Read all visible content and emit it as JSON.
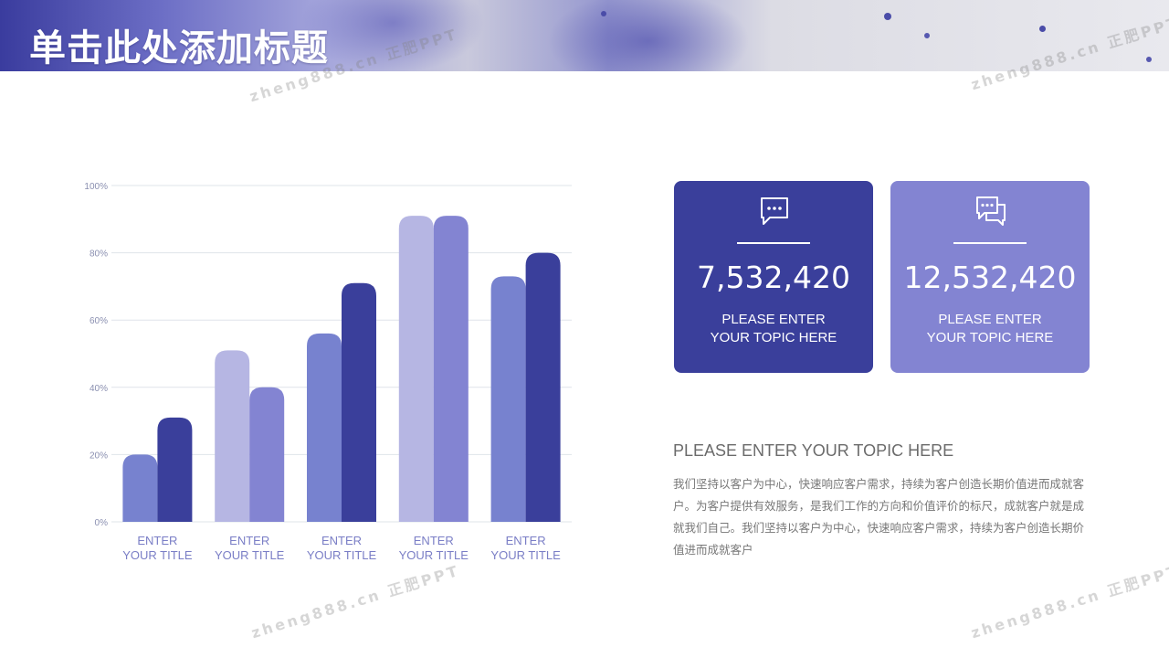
{
  "header": {
    "title": "单击此处添加标题"
  },
  "watermark": {
    "text": "zheng888.cn 正肥PPT"
  },
  "colors": {
    "dark": "#3a3f9b",
    "medium": "#8384d2",
    "light": "#b6b6e3",
    "steel": "#7782cf",
    "grid": "#dfe4ea",
    "axis_text": "#8a8fb0",
    "category_text": "#7a7ec6"
  },
  "chart_data": {
    "type": "bar",
    "categories": [
      "ENTER\nYOUR TITLE",
      "ENTER\nYOUR TITLE",
      "ENTER\nYOUR TITLE",
      "ENTER\nYOUR TITLE",
      "ENTER\nYOUR TITLE"
    ],
    "series": [
      {
        "values": [
          20,
          51,
          56,
          91,
          73
        ],
        "colors": [
          "#7782cf",
          "#b6b6e3",
          "#7782cf",
          "#b6b6e3",
          "#7782cf"
        ]
      },
      {
        "values": [
          31,
          40,
          71,
          91,
          80
        ],
        "colors": [
          "#3a3f9b",
          "#8384d2",
          "#3a3f9b",
          "#8384d2",
          "#3a3f9b"
        ]
      }
    ],
    "ylim": [
      0,
      100
    ],
    "yticks": [
      0,
      20,
      40,
      60,
      80,
      100
    ],
    "ytick_labels": [
      "0%",
      "20%",
      "40%",
      "60%",
      "80%",
      "100%"
    ],
    "grid": true,
    "legend": "none"
  },
  "cards": [
    {
      "icon": "chat-bubble-icon",
      "value": "7,532,420",
      "label": "PLEASE ENTER\nYOUR TOPIC HERE"
    },
    {
      "icon": "chat-bubbles-icon",
      "value": "12,532,420",
      "label": "PLEASE ENTER\nYOUR TOPIC HERE"
    }
  ],
  "topic": {
    "title": "PLEASE ENTER YOUR TOPIC HERE",
    "body": "我们坚持以客户为中心，快速响应客户需求，持续为客户创造长期价值进而成就客户。为客户提供有效服务，是我们工作的方向和价值评价的标尺，成就客户就是成就我们自己。我们坚持以客户为中心，快速响应客户需求，持续为客户创造长期价值进而成就客户"
  }
}
